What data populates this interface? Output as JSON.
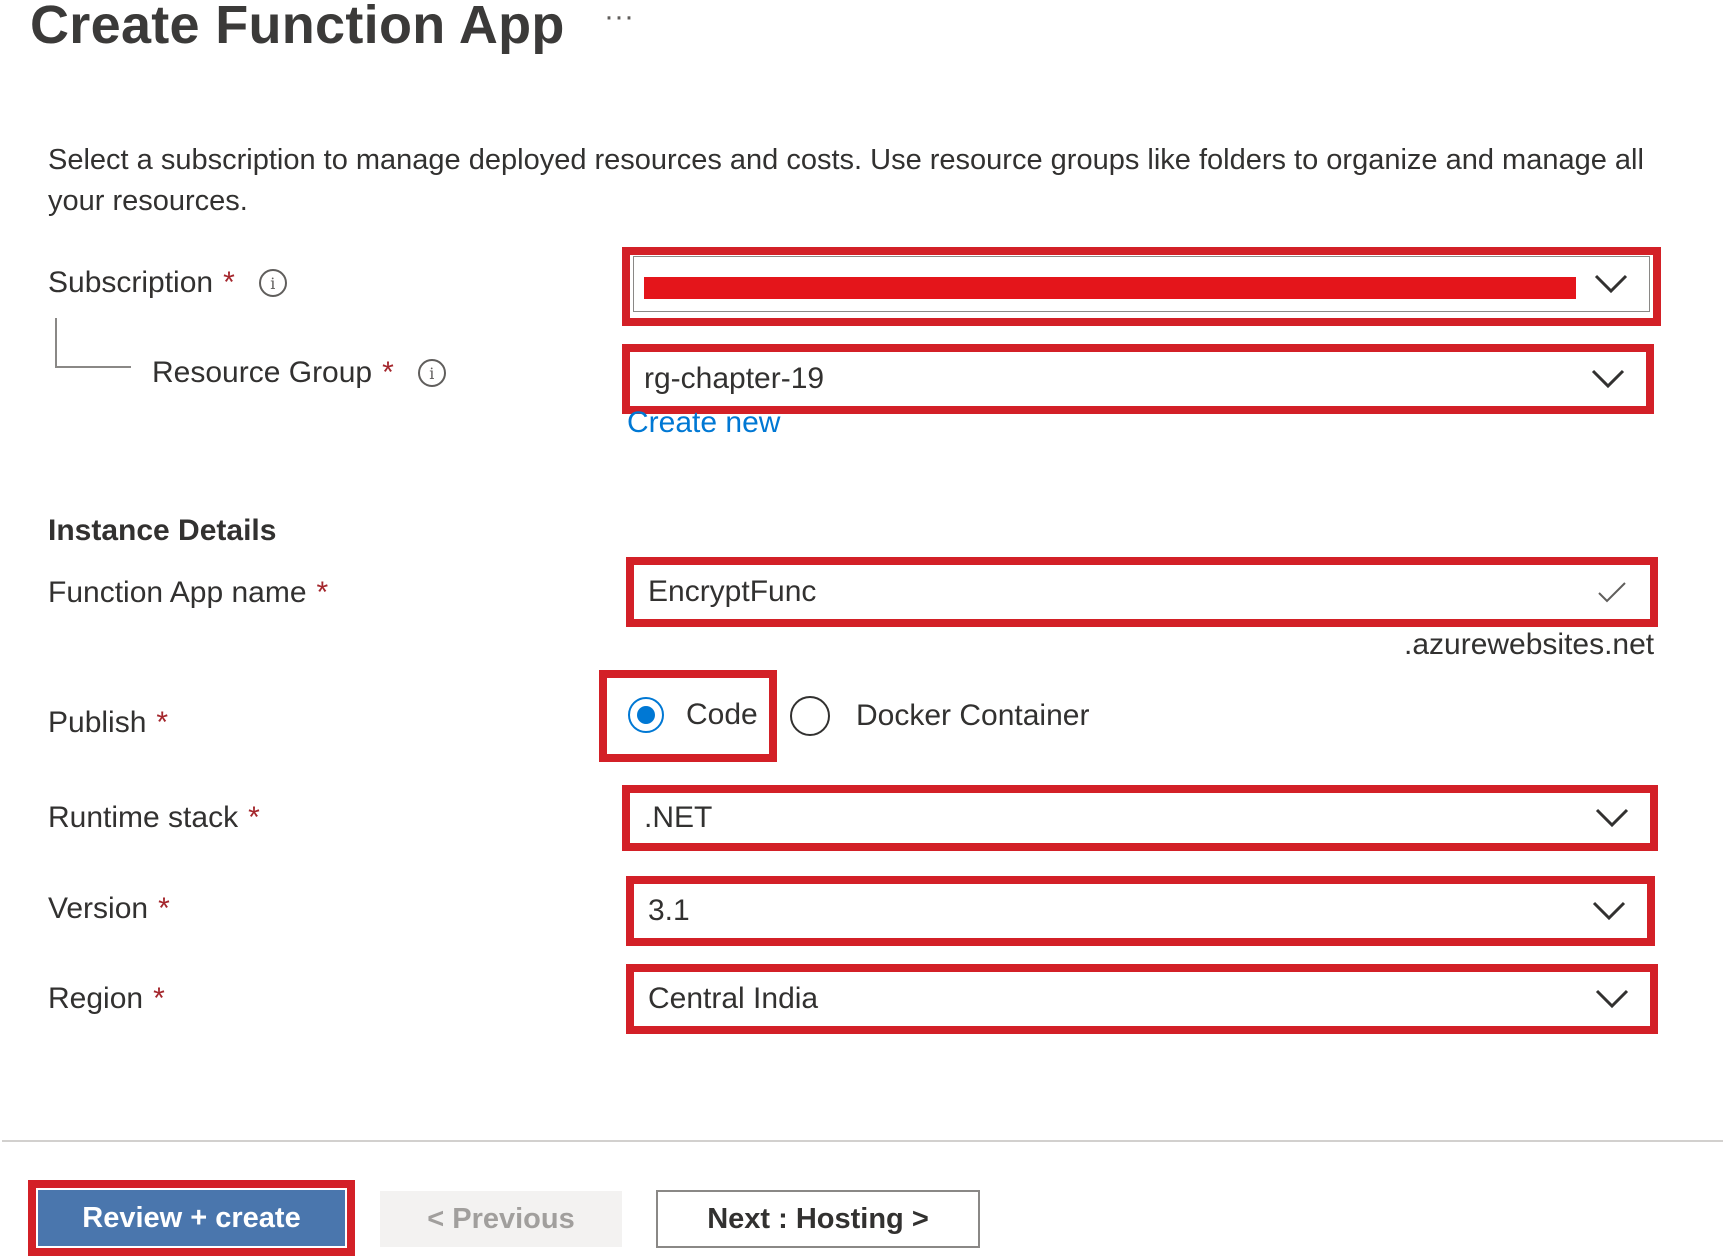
{
  "header": {
    "title": "Create Function App",
    "more": "···"
  },
  "description": "Select a subscription to manage deployed resources and costs. Use resource groups like folders to organize and manage all your resources.",
  "required_marker": "*",
  "info_glyph": "i",
  "subscription": {
    "label": "Subscription",
    "value": ""
  },
  "resource_group": {
    "label": "Resource Group",
    "value": "rg-chapter-19",
    "create_new": "Create new"
  },
  "instance_details": {
    "heading": "Instance Details"
  },
  "function_app_name": {
    "label": "Function App name",
    "value": "EncryptFunc",
    "suffix": ".azurewebsites.net"
  },
  "publish": {
    "label": "Publish",
    "options": [
      {
        "label": "Code",
        "selected": true
      },
      {
        "label": "Docker Container",
        "selected": false
      }
    ]
  },
  "runtime_stack": {
    "label": "Runtime stack",
    "value": ".NET"
  },
  "version": {
    "label": "Version",
    "value": "3.1"
  },
  "region": {
    "label": "Region",
    "value": "Central India"
  },
  "footer": {
    "review_create": "Review + create",
    "previous": "< Previous",
    "next": "Next : Hosting >"
  },
  "colors": {
    "highlight": "#d32027",
    "accent": "#0078d4",
    "primary_button": "#4a76ad",
    "required": "#a4262c"
  }
}
